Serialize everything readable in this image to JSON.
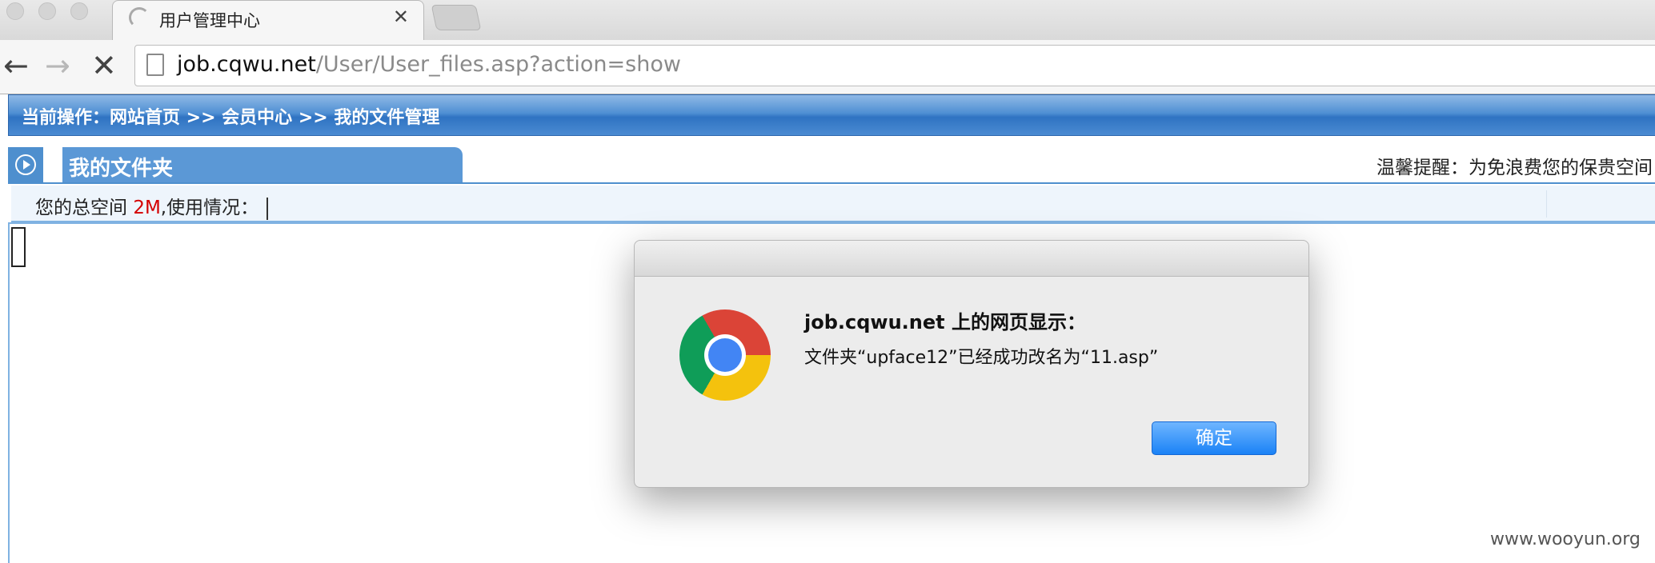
{
  "browser": {
    "tab": {
      "title": "用户管理中心",
      "close": "✕"
    },
    "nav": {
      "back": "←",
      "forward": "→",
      "stop": "✕"
    },
    "address": {
      "host": "job.cqwu.net",
      "path": "/User/User_files.asp?action=show"
    }
  },
  "page": {
    "breadcrumb": "当前操作：网站首页 >> 会员中心 >> 我的文件管理",
    "section_title": "我的文件夹",
    "tip": "温馨提醒：为免浪费您的保贵空间",
    "usage": {
      "prefix": "您的总空间 ",
      "size": "2M",
      "suffix": ",使用情况："
    }
  },
  "dialog": {
    "title": "job.cqwu.net 上的网页显示：",
    "message": "文件夹“upface12”已经成功改名为“11.asp”",
    "ok_label": "确定"
  },
  "watermark": "www.wooyun.org"
}
